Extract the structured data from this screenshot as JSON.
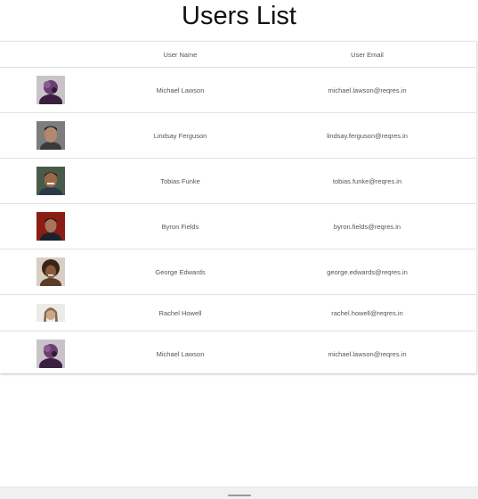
{
  "page": {
    "title": "Users List"
  },
  "table": {
    "headers": {
      "avatar": "",
      "name": "User Name",
      "email": "User Email"
    },
    "rows": [
      {
        "name": "Michael Lawson",
        "email": "michael.lawson@reqres.in",
        "avatar_icon": "portrait-purple-avatar"
      },
      {
        "name": "Lindsay Ferguson",
        "email": "lindsay.ferguson@reqres.in",
        "avatar_icon": "portrait-man-grey-avatar"
      },
      {
        "name": "Tobias Funke",
        "email": "tobias.funke@reqres.in",
        "avatar_icon": "portrait-man-dark-avatar"
      },
      {
        "name": "Byron Fields",
        "email": "byron.fields@reqres.in",
        "avatar_icon": "portrait-man-red-avatar"
      },
      {
        "name": "George Edwards",
        "email": "george.edwards@reqres.in",
        "avatar_icon": "portrait-man-curly-avatar"
      },
      {
        "name": "Rachel Howell",
        "email": "rachel.howell@reqres.in",
        "avatar_icon": "portrait-woman-light-avatar"
      },
      {
        "name": "Michael Lawson",
        "email": "michael.lawson@reqres.in",
        "avatar_icon": "portrait-purple-avatar"
      }
    ]
  },
  "colors": {
    "text": "#555555",
    "title": "#111111",
    "divider": "#e2e2e2",
    "bottom_bar": "#eef0f2"
  },
  "bottom_bar": {
    "icon": "home-indicator-icon"
  }
}
